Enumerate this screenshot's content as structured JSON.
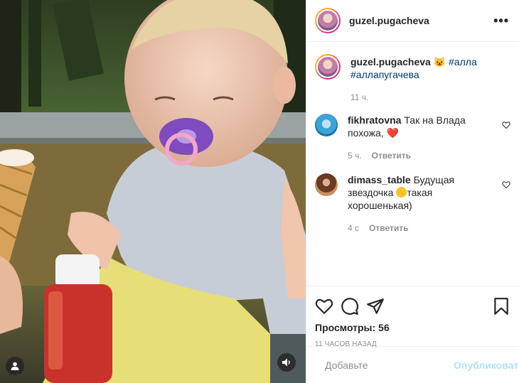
{
  "post": {
    "username": "guzel.pugacheva",
    "more_label": "•••"
  },
  "caption": {
    "username": "guzel.pugacheva",
    "emoji": "😺",
    "tags": [
      "#алла",
      "#аллапугачева"
    ],
    "time": "11 ч."
  },
  "comments": [
    {
      "username": "fikhratovna",
      "text": "Так на Влада похожа,",
      "emoji": "❤️",
      "time": "5 ч.",
      "reply_label": "Ответить"
    },
    {
      "username": "dimass_table",
      "text_before": "Будущая звездочка",
      "text_after": "такая хорошенькая)",
      "time": "4 с",
      "reply_label": "Ответить"
    }
  ],
  "stats": {
    "views_label": "Просмотры: 56",
    "time_ago": "11 часов назад"
  },
  "composer": {
    "placeholder": "Добавьте",
    "publish_label": "Опубликовать"
  },
  "icons": {
    "like": "heart-icon",
    "comment": "comment-bubble-icon",
    "share": "paper-plane-icon",
    "save": "bookmark-icon",
    "emoji": "smiley-icon",
    "sound": "speaker-icon",
    "tagged_user": "user-icon"
  },
  "colors": {
    "link": "#00376b",
    "muted": "#8e8e8e",
    "publish_disabled": "#b2dffc",
    "heart": "#ed4956"
  }
}
